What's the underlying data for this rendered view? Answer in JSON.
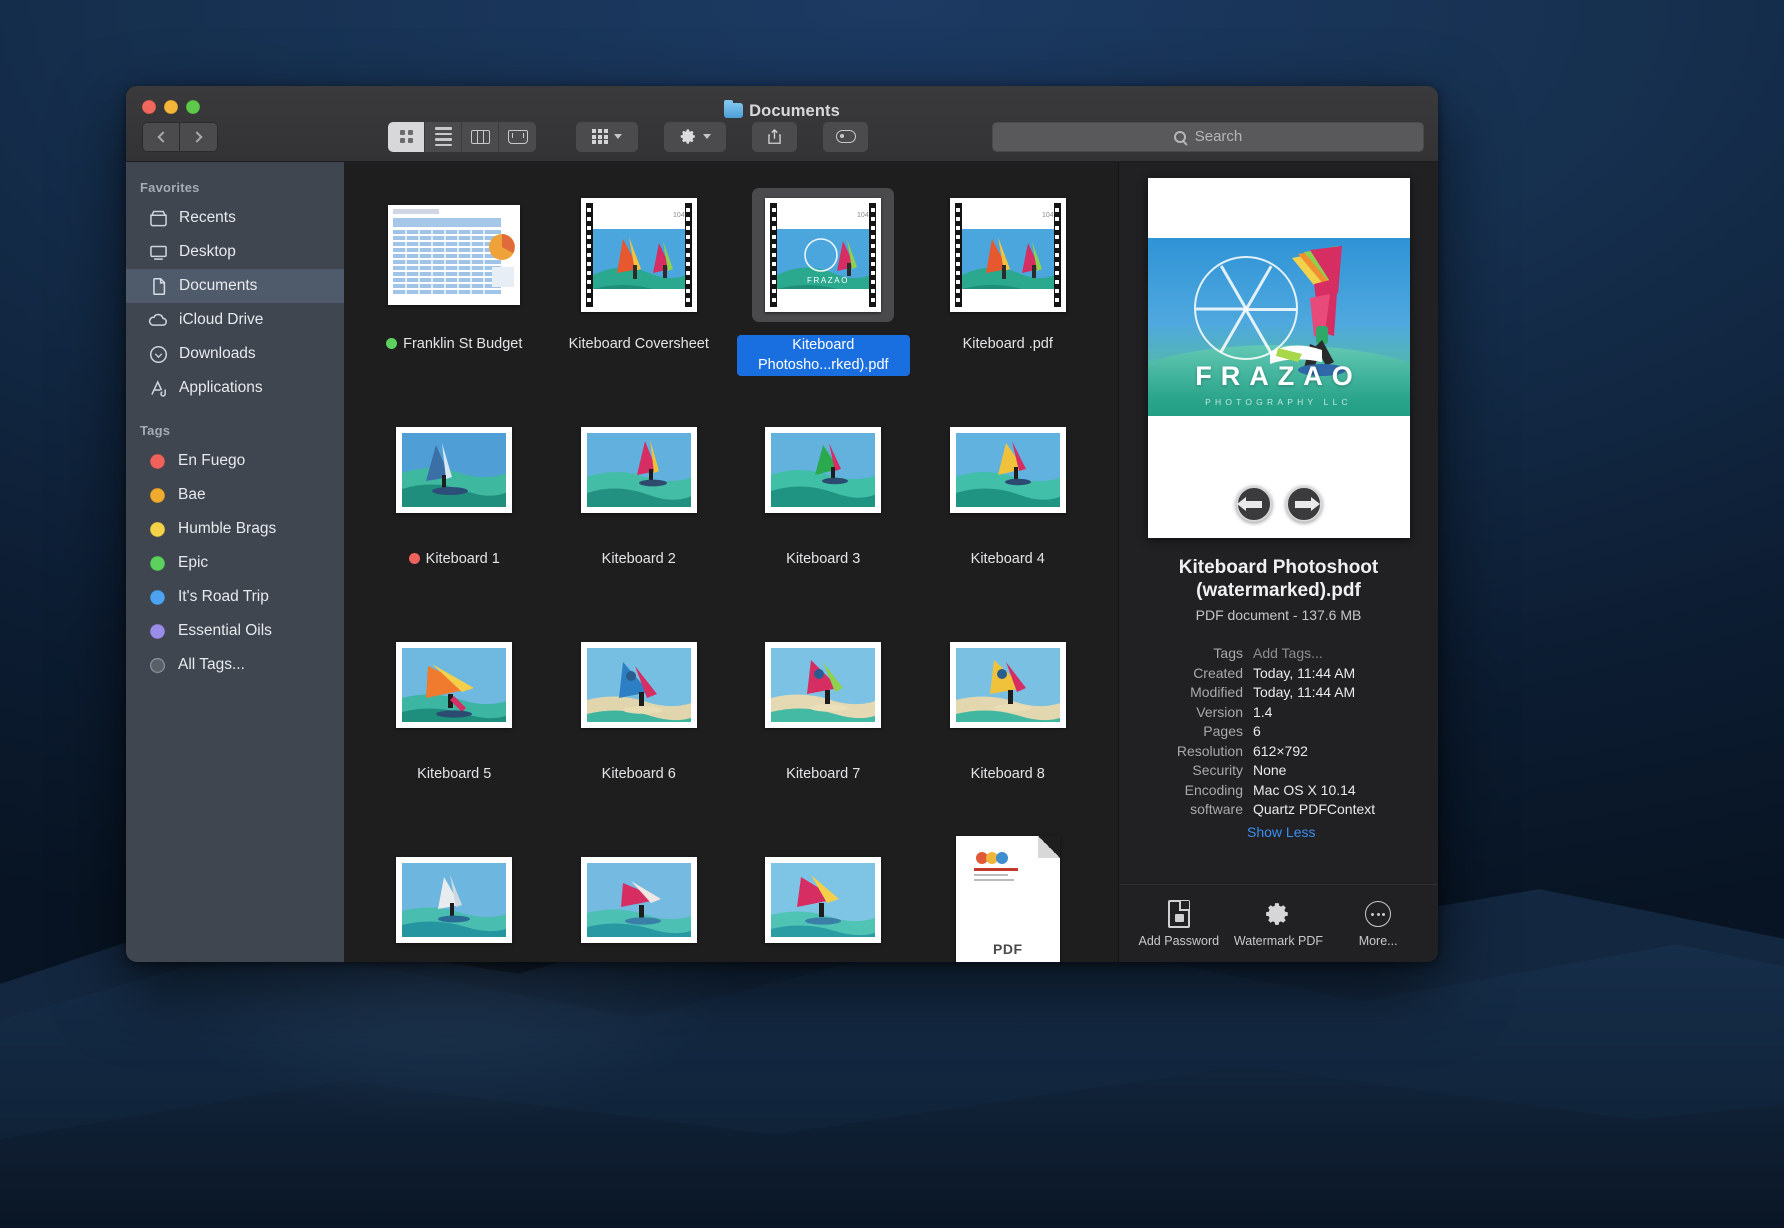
{
  "window": {
    "title": "Documents",
    "folder_icon": "folder-icon",
    "traffic_lights": [
      "close",
      "minimize",
      "zoom"
    ]
  },
  "toolbar": {
    "back_label": "Back",
    "forward_label": "Forward",
    "view_modes": [
      {
        "name": "icon-view",
        "icon": "grid-icon",
        "active": true
      },
      {
        "name": "list-view",
        "icon": "list-icon",
        "active": false
      },
      {
        "name": "column-view",
        "icon": "columns-icon",
        "active": false
      },
      {
        "name": "gallery-view",
        "icon": "gallery-icon",
        "active": false
      }
    ],
    "arrange_label": "Arrange",
    "action_label": "Action",
    "share_label": "Share",
    "tags_label": "Tags"
  },
  "search": {
    "placeholder": "Search",
    "value": "",
    "icon": "search-icon"
  },
  "sidebar": {
    "sections": [
      {
        "header": "Favorites",
        "items": [
          {
            "label": "Recents",
            "icon": "clock-disk-icon",
            "selected": false
          },
          {
            "label": "Desktop",
            "icon": "desktop-icon",
            "selected": false
          },
          {
            "label": "Documents",
            "icon": "documents-icon",
            "selected": true
          },
          {
            "label": "iCloud Drive",
            "icon": "cloud-icon",
            "selected": false
          },
          {
            "label": "Downloads",
            "icon": "download-icon",
            "selected": false
          },
          {
            "label": "Applications",
            "icon": "applications-icon",
            "selected": false
          }
        ]
      },
      {
        "header": "Tags",
        "items": [
          {
            "label": "En Fuego",
            "icon": "tag-dot-icon",
            "color": "#f0635c",
            "selected": false
          },
          {
            "label": "Bae",
            "icon": "tag-dot-icon",
            "color": "#eeab2e",
            "selected": false
          },
          {
            "label": "Humble Brags",
            "icon": "tag-dot-icon",
            "color": "#f2d34a",
            "selected": false
          },
          {
            "label": "Epic",
            "icon": "tag-dot-icon",
            "color": "#5cd15e",
            "selected": false
          },
          {
            "label": "It's Road Trip",
            "icon": "tag-dot-icon",
            "color": "#4da3ef",
            "selected": false
          },
          {
            "label": "Essential Oils",
            "icon": "tag-dot-icon",
            "color": "#9a8de8",
            "selected": false
          },
          {
            "label": "All Tags...",
            "icon": "all-tags-icon",
            "color": "#6b6b6d",
            "selected": false
          }
        ]
      }
    ]
  },
  "files": [
    {
      "name": "Franklin St Budget",
      "kind": "spreadsheet",
      "tag_color": "#5cd15e",
      "selected": false
    },
    {
      "name": "Kiteboard Coversheet",
      "kind": "pdf-film",
      "tag_color": null,
      "selected": false
    },
    {
      "name": "Kiteboard Photosho...rked).pdf",
      "kind": "pdf-film",
      "tag_color": null,
      "selected": true
    },
    {
      "name": "Kiteboard .pdf",
      "kind": "pdf-film",
      "tag_color": null,
      "selected": false
    },
    {
      "name": "Kiteboard 1",
      "kind": "photo",
      "tag_color": "#f0635c",
      "selected": false
    },
    {
      "name": "Kiteboard 2",
      "kind": "photo",
      "tag_color": null,
      "selected": false
    },
    {
      "name": "Kiteboard 3",
      "kind": "photo",
      "tag_color": null,
      "selected": false
    },
    {
      "name": "Kiteboard 4",
      "kind": "photo",
      "tag_color": null,
      "selected": false
    },
    {
      "name": "Kiteboard 5",
      "kind": "photo",
      "tag_color": null,
      "selected": false
    },
    {
      "name": "Kiteboard 6",
      "kind": "photo",
      "tag_color": null,
      "selected": false
    },
    {
      "name": "Kiteboard 7",
      "kind": "photo",
      "tag_color": null,
      "selected": false
    },
    {
      "name": "Kiteboard 8",
      "kind": "photo",
      "tag_color": null,
      "selected": false
    },
    {
      "name": "",
      "kind": "photo",
      "tag_color": null,
      "selected": false
    },
    {
      "name": "",
      "kind": "photo",
      "tag_color": null,
      "selected": false
    },
    {
      "name": "",
      "kind": "photo",
      "tag_color": null,
      "selected": false
    },
    {
      "name": "",
      "kind": "pdf-page",
      "tag_color": null,
      "selected": false
    }
  ],
  "preview": {
    "watermark_brand": "FRAZAO",
    "watermark_sub": "PHOTOGRAPHY LLC",
    "prev_label": "Previous page",
    "next_label": "Next page"
  },
  "info": {
    "title": "Kiteboard  Photoshoot (watermarked).pdf",
    "subtitle": "PDF document - 137.6 MB",
    "rows": [
      {
        "key": "Tags",
        "value": "Add Tags...",
        "muted": true
      },
      {
        "key": "Created",
        "value": "Today, 11:44 AM",
        "muted": false
      },
      {
        "key": "Modified",
        "value": "Today, 11:44 AM",
        "muted": false
      },
      {
        "key": "Version",
        "value": "1.4",
        "muted": false
      },
      {
        "key": "Pages",
        "value": "6",
        "muted": false
      },
      {
        "key": "Resolution",
        "value": "612×792",
        "muted": false
      },
      {
        "key": "Security",
        "value": "None",
        "muted": false
      },
      {
        "key": "Encoding",
        "value": "Mac OS X 10.14",
        "muted": false
      },
      {
        "key": "software",
        "value": "Quartz PDFContext",
        "muted": false
      }
    ],
    "show_less": "Show Less",
    "actions": [
      {
        "label": "Add Password",
        "icon": "locked-document-icon"
      },
      {
        "label": "Watermark PDF",
        "icon": "gear-icon"
      },
      {
        "label": "More...",
        "icon": "ellipsis-circle-icon"
      }
    ]
  },
  "colors": {
    "accent_blue": "#1a6fe0",
    "link_blue": "#3a8df0",
    "sidebar_bg": "#3f4650",
    "content_bg": "#1e1e1e",
    "info_bg": "#212123"
  }
}
